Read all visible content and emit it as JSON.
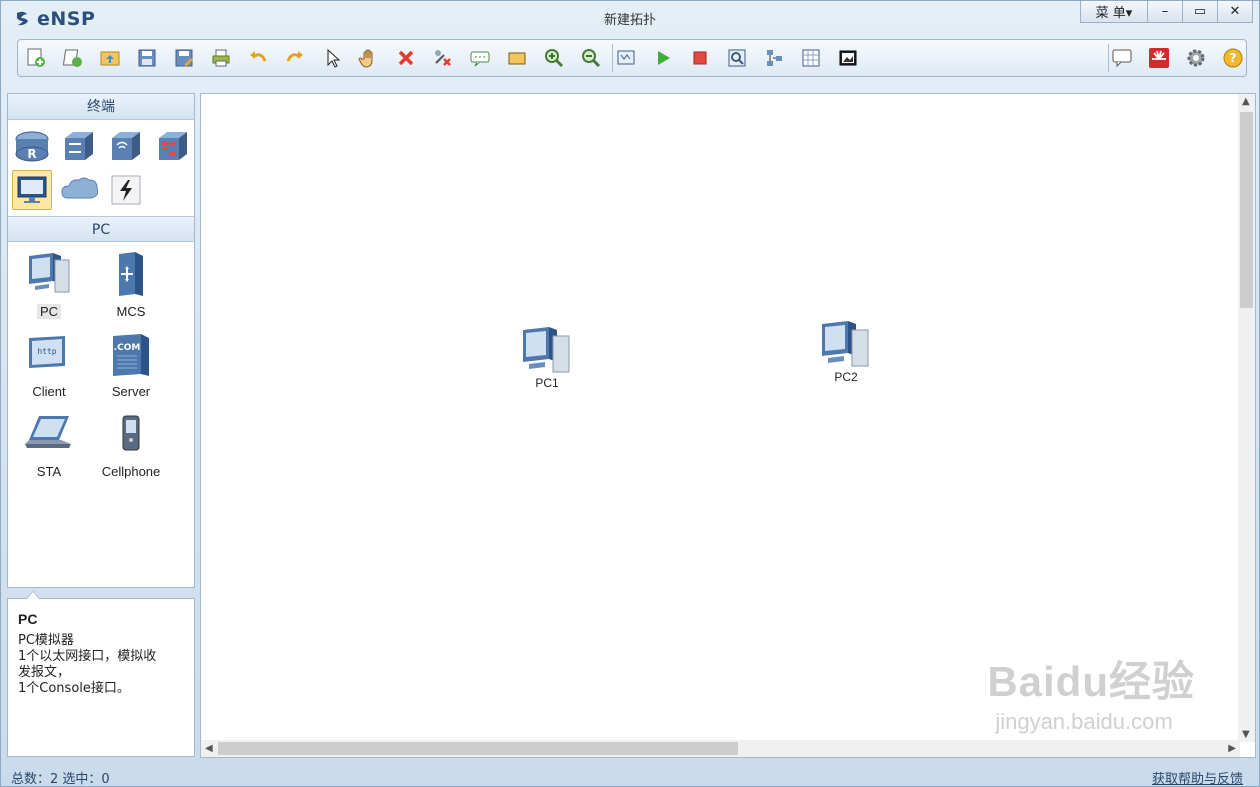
{
  "app": {
    "name": "eNSP",
    "title": "新建拓扑"
  },
  "window_controls": {
    "menu_label": "菜 单▾",
    "minimize": "–",
    "maximize": "▭",
    "close": "✕"
  },
  "toolbar": {
    "left_icons": [
      "new-topology-icon",
      "new-example-icon",
      "open-icon",
      "save-icon",
      "save-as-icon",
      "print-icon",
      "undo-icon",
      "redo-icon",
      "select-icon",
      "pan-hand-icon",
      "delete-icon",
      "delete-link-icon",
      "text-icon",
      "rectangle-icon",
      "zoom-in-icon",
      "zoom-out-icon",
      "fit-view-icon",
      "start-device-icon",
      "stop-device-icon",
      "capture-icon",
      "topology-icon",
      "grid-icon",
      "screenshot-icon"
    ],
    "right_icons": [
      "chat-icon",
      "huawei-logo-icon",
      "settings-gear-icon",
      "help-icon"
    ]
  },
  "left_panel": {
    "category_header": "终端",
    "categories": [
      {
        "name": "router-category-icon"
      },
      {
        "name": "switch-category-icon"
      },
      {
        "name": "wlan-category-icon"
      },
      {
        "name": "firewall-category-icon"
      },
      {
        "name": "terminal-category-icon",
        "selected": true
      },
      {
        "name": "cloud-category-icon"
      },
      {
        "name": "link-category-icon"
      }
    ],
    "device_header": "PC",
    "devices": [
      {
        "label": "PC",
        "icon": "pc-icon",
        "selected": true
      },
      {
        "label": "MCS",
        "icon": "mcs-icon"
      },
      {
        "label": "Client",
        "icon": "client-icon"
      },
      {
        "label": "Server",
        "icon": "server-icon"
      },
      {
        "label": "STA",
        "icon": "sta-icon"
      },
      {
        "label": "Cellphone",
        "icon": "cellphone-icon"
      }
    ]
  },
  "description": {
    "title": "PC",
    "lines": [
      "PC模拟器",
      "1个以太网接口，模拟收",
      "发报文，",
      "1个Console接口。"
    ]
  },
  "canvas": {
    "nodes": [
      {
        "label": "PC1",
        "icon": "pc-icon"
      },
      {
        "label": "PC2",
        "icon": "pc-icon"
      }
    ],
    "watermark": {
      "top": "Baidu经验",
      "bottom": "jingyan.baidu.com"
    }
  },
  "status": {
    "left": "总数：2  选中：0",
    "right": "获取帮助与反馈"
  }
}
